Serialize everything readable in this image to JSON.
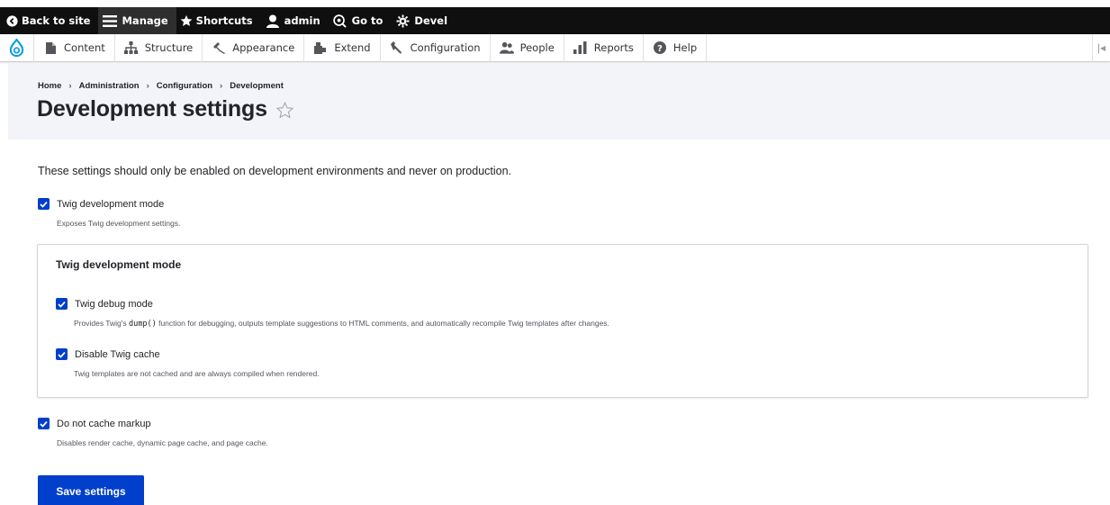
{
  "toolbar": {
    "items": [
      {
        "label": "Back to site",
        "icon": "back-circle-icon"
      },
      {
        "label": "Manage",
        "icon": "hamburger-icon"
      },
      {
        "label": "Shortcuts",
        "icon": "star-icon"
      },
      {
        "label": "admin",
        "icon": "user-icon"
      },
      {
        "label": "Go to",
        "icon": "goto-icon"
      },
      {
        "label": "Devel",
        "icon": "gear-icon"
      }
    ]
  },
  "tray": {
    "items": [
      {
        "label": "Content",
        "icon": "file-icon"
      },
      {
        "label": "Structure",
        "icon": "structure-icon"
      },
      {
        "label": "Appearance",
        "icon": "paintbrush-icon"
      },
      {
        "label": "Extend",
        "icon": "puzzle-icon"
      },
      {
        "label": "Configuration",
        "icon": "wrench-icon"
      },
      {
        "label": "People",
        "icon": "people-icon"
      },
      {
        "label": "Reports",
        "icon": "bar-chart-icon"
      },
      {
        "label": "Help",
        "icon": "help-icon"
      }
    ]
  },
  "breadcrumb": {
    "items": [
      "Home",
      "Administration",
      "Configuration",
      "Development"
    ],
    "separator": "›"
  },
  "page": {
    "title": "Development settings",
    "intro": "These settings should only be enabled on development environments and never on production."
  },
  "settings": {
    "twig_dev_mode": {
      "label": "Twig development mode",
      "description": "Exposes Twig development settings.",
      "checked": true
    },
    "twig_group": {
      "title": "Twig development mode",
      "debug": {
        "label": "Twig debug mode",
        "description_pre": "Provides Twig's ",
        "description_code": "dump()",
        "description_post": " function for debugging, outputs template suggestions to HTML comments, and automatically recompile Twig templates after changes.",
        "checked": true
      },
      "cache": {
        "label": "Disable Twig cache",
        "description": "Twig templates are not cached and are always compiled when rendered.",
        "checked": true
      }
    },
    "no_cache_markup": {
      "label": "Do not cache markup",
      "description": "Disables render cache, dynamic page cache, and page cache.",
      "checked": true
    }
  },
  "actions": {
    "save_label": "Save settings"
  },
  "colors": {
    "toolbar_bg": "#0f0f0f",
    "accent": "#003ecc",
    "header_bg": "#f3f4f9",
    "drupal_blue": "#009cde"
  }
}
